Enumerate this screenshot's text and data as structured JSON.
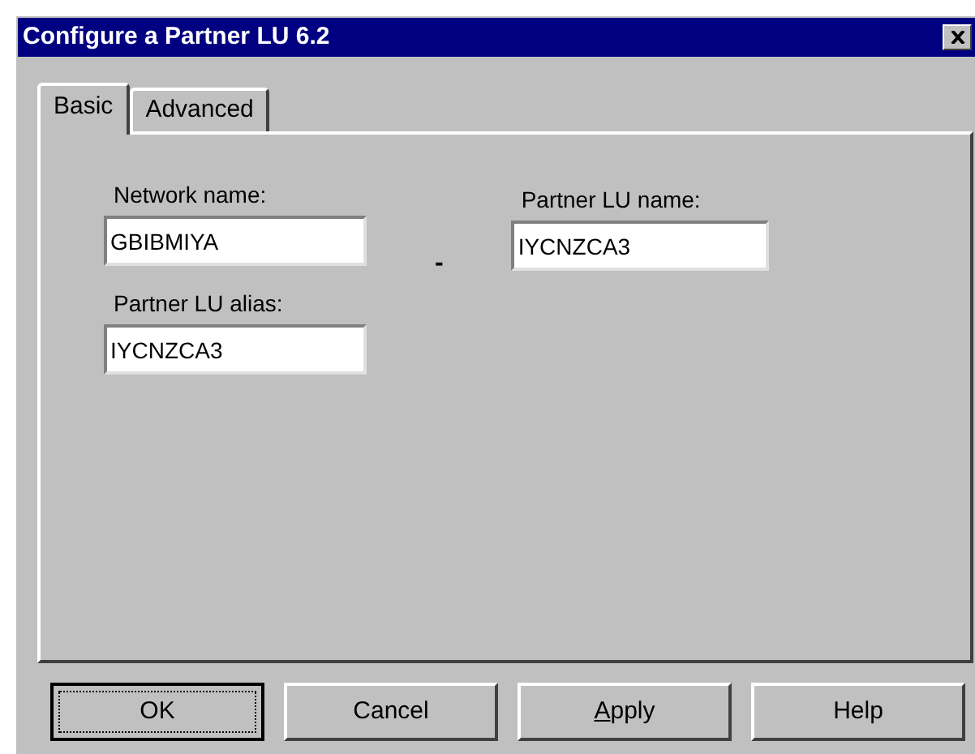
{
  "window": {
    "title": "Configure a Partner LU 6.2"
  },
  "tabs": [
    {
      "label": "Basic",
      "selected": true
    },
    {
      "label": "Advanced",
      "selected": false
    }
  ],
  "fields": {
    "network_name": {
      "label": "Network name:",
      "value": "GBIBMIYA"
    },
    "separator": "-",
    "partner_lu_name": {
      "label": "Partner LU name:",
      "value": "IYCNZCA3"
    },
    "partner_lu_alias": {
      "label": "Partner LU alias:",
      "value": "IYCNZCA3"
    }
  },
  "buttons": [
    {
      "label": "OK",
      "default": true,
      "accel": false
    },
    {
      "label": "Cancel",
      "default": false,
      "accel": false
    },
    {
      "label": "Apply",
      "default": false,
      "accel": true
    },
    {
      "label": "Help",
      "default": false,
      "accel": false
    }
  ]
}
